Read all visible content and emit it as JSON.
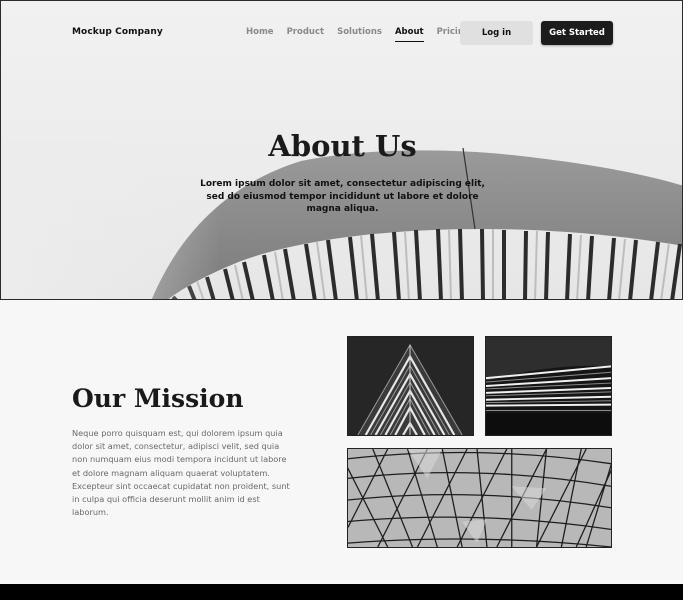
{
  "brand": {
    "name": "Mockup Company"
  },
  "nav": {
    "links": [
      {
        "label": "Home",
        "active": false
      },
      {
        "label": "Product",
        "active": false
      },
      {
        "label": "Solutions",
        "active": false
      },
      {
        "label": "About",
        "active": true
      },
      {
        "label": "Pricing",
        "active": false
      }
    ],
    "login_label": "Log in",
    "cta_label": "Get Started"
  },
  "hero": {
    "title": "About Us",
    "subtitle": "Lorem ipsum dolor sit amet, consectetur adipiscing elit, sed do eiusmod tempor incididunt ut labore et dolore magna aliqua."
  },
  "mission": {
    "title": "Our Mission",
    "text": "Neque porro quisquam est, qui dolorem ipsum quia dolor sit amet, consectetur, adipisci velit, sed quia non numquam eius modi tempora incidunt ut labore et dolore magnam aliquam quaerat voluptatem. Excepteur sint occaecat cupidatat non proident, sunt in culpa qui officia deserunt mollit anim id est laborum."
  },
  "colors": {
    "primary": "#1c1c1c",
    "muted_text": "#6a6a6a",
    "nav_inactive": "#8a8a8a",
    "login_bg": "#e0e0e0",
    "page_bg": "#f7f7f7"
  }
}
